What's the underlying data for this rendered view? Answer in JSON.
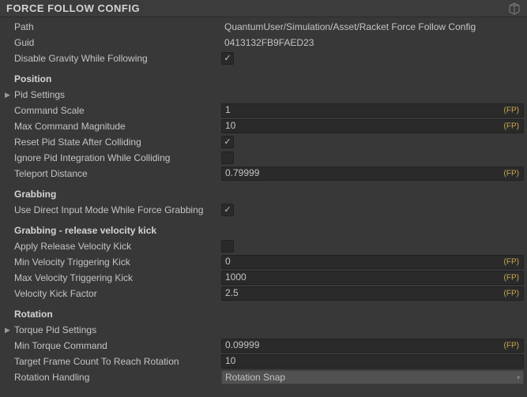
{
  "header": {
    "title": "FORCE FOLLOW CONFIG"
  },
  "fp_label": "(FP)",
  "top": {
    "path_label": "Path",
    "path_value": "QuantumUser/Simulation/Asset/Racket Force Follow Config",
    "guid_label": "Guid",
    "guid_value": "0413132FB9FAED23",
    "disable_gravity_label": "Disable Gravity While Following"
  },
  "position": {
    "heading": "Position",
    "pid_settings_label": "Pid Settings",
    "command_scale_label": "Command Scale",
    "command_scale_value": "1",
    "max_command_label": "Max Command Magnitude",
    "max_command_value": "10",
    "reset_pid_label": "Reset Pid State After Colliding",
    "ignore_pid_label": "Ignore Pid Integration While Colliding",
    "teleport_label": "Teleport Distance",
    "teleport_value": "0.79999"
  },
  "grabbing": {
    "heading": "Grabbing",
    "direct_input_label": "Use Direct Input Mode While Force Grabbing"
  },
  "release": {
    "heading": "Grabbing - release velocity kick",
    "apply_kick_label": "Apply Release Velocity Kick",
    "min_vel_label": "Min Velocity Triggering Kick",
    "min_vel_value": "0",
    "max_vel_label": "Max Velocity Triggering Kick",
    "max_vel_value": "1000",
    "kick_factor_label": "Velocity Kick Factor",
    "kick_factor_value": "2.5"
  },
  "rotation": {
    "heading": "Rotation",
    "torque_pid_label": "Torque Pid Settings",
    "min_torque_label": "Min Torque Command",
    "min_torque_value": "0.09999",
    "target_frame_label": "Target Frame Count To Reach Rotation",
    "target_frame_value": "10",
    "rotation_handling_label": "Rotation Handling",
    "rotation_handling_value": "Rotation Snap"
  }
}
